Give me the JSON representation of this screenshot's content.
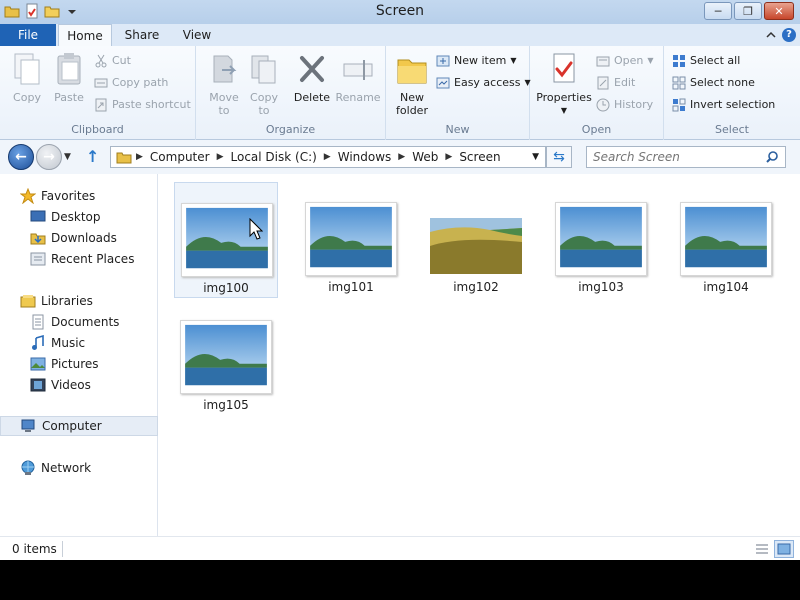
{
  "window": {
    "title": "Screen"
  },
  "titlebar": {
    "minimize": "─",
    "maximize": "❐",
    "close": "✕"
  },
  "tabs": {
    "file": "File",
    "home": "Home",
    "share": "Share",
    "view": "View"
  },
  "ribbon": {
    "clipboard": {
      "label": "Clipboard",
      "copy": "Copy",
      "paste": "Paste",
      "cut": "Cut",
      "copy_path": "Copy path",
      "paste_shortcut": "Paste shortcut"
    },
    "organize": {
      "label": "Organize",
      "move_to_1": "Move",
      "move_to_2": "to",
      "copy_to_1": "Copy",
      "copy_to_2": "to",
      "delete": "Delete",
      "rename": "Rename"
    },
    "new": {
      "label": "New",
      "new_folder_1": "New",
      "new_folder_2": "folder",
      "new_item": "New item",
      "easy_access": "Easy access"
    },
    "open": {
      "label": "Open",
      "properties": "Properties",
      "open": "Open",
      "edit": "Edit",
      "history": "History"
    },
    "select": {
      "label": "Select",
      "select_all": "Select all",
      "select_none": "Select none",
      "invert_selection": "Invert selection"
    }
  },
  "address": {
    "crumbs": [
      "Computer",
      "Local Disk (C:)",
      "Windows",
      "Web",
      "Screen"
    ]
  },
  "search": {
    "placeholder": "Search Screen"
  },
  "nav": {
    "favorites": "Favorites",
    "desktop": "Desktop",
    "downloads": "Downloads",
    "recent_places": "Recent Places",
    "libraries": "Libraries",
    "documents": "Documents",
    "music": "Music",
    "pictures": "Pictures",
    "videos": "Videos",
    "computer": "Computer",
    "network": "Network"
  },
  "files": [
    {
      "name": "img100"
    },
    {
      "name": "img101"
    },
    {
      "name": "img102"
    },
    {
      "name": "img103"
    },
    {
      "name": "img104"
    },
    {
      "name": "img105"
    }
  ],
  "status": {
    "items": "0 items"
  },
  "colors": {
    "accent": "#1f63b5",
    "ribbon_bg": "#eaf1fa",
    "selection": "#e6edf6"
  }
}
